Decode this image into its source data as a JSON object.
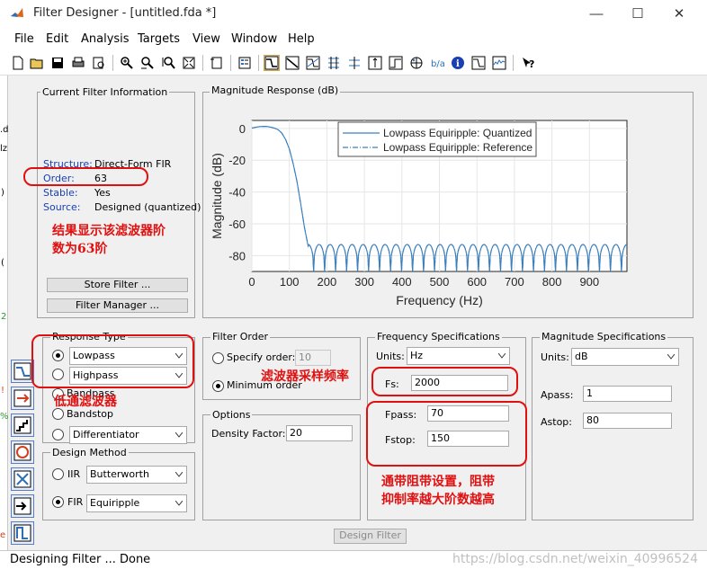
{
  "window": {
    "title": "Filter Designer  -  [untitled.fda *]",
    "minimize": "—",
    "maximize": "☐",
    "close": "✕"
  },
  "menus": [
    "File",
    "Edit",
    "Analysis",
    "Targets",
    "View",
    "Window",
    "Help"
  ],
  "toolbar": {
    "icons": [
      "new-icon",
      "open-icon",
      "save-icon",
      "print-icon",
      "print-preview-icon",
      "zoom-in-icon",
      "zoom-x-icon",
      "zoom-y-icon",
      "full-view-icon",
      "new-plot-icon",
      "legend-icon",
      "magnitude-icon",
      "phase-icon",
      "mag-phase-icon",
      "group-delay-icon",
      "phase-delay-icon",
      "impulse-icon",
      "step-icon",
      "pole-zero-icon",
      "coefficients-icon",
      "info-icon",
      "magnitude-estimate-icon",
      "noise-icon",
      "whats-this-icon"
    ],
    "active": [
      "magnitude-icon"
    ]
  },
  "current_filter": {
    "title": "Current Filter Information",
    "rows": [
      {
        "key": "Structure:",
        "value": "Direct-Form FIR"
      },
      {
        "key": "Order:",
        "value": "63"
      },
      {
        "key": "Stable:",
        "value": "Yes"
      },
      {
        "key": "Source:",
        "value": "Designed (quantized)"
      }
    ],
    "store_button": "Store Filter ...",
    "manager_button": "Filter Manager ..."
  },
  "plot": {
    "title": "Magnitude Response (dB)"
  },
  "chart_data": {
    "type": "line",
    "xlabel": "Frequency (Hz)",
    "ylabel": "Magnitude (dB)",
    "xlim": [
      0,
      1000
    ],
    "ylim": [
      -90,
      5
    ],
    "xticks": [
      0,
      100,
      200,
      300,
      400,
      500,
      600,
      700,
      800,
      900
    ],
    "yticks": [
      0,
      -20,
      -40,
      -60,
      -80
    ],
    "grid": true,
    "legend_position": "top-right",
    "color": "#3a7fbf",
    "passband": {
      "x": [
        0,
        10,
        20,
        30,
        40,
        50,
        60,
        70,
        80,
        90,
        100,
        110,
        120,
        130,
        140,
        150
      ],
      "y": [
        0.2,
        0.7,
        1.1,
        1.3,
        1.2,
        0.8,
        0.2,
        -0.8,
        -3,
        -7,
        -13,
        -22,
        -33,
        -47,
        -62,
        -74
      ]
    },
    "stopband": {
      "fstop": 150,
      "fmax": 1000,
      "lobes": 29,
      "peak_db": -73,
      "floor_db": -90
    },
    "series": [
      {
        "name": "Lowpass Equiripple: Quantized",
        "style": "solid"
      },
      {
        "name": "Lowpass Equiripple: Reference",
        "style": "dashdot"
      }
    ]
  },
  "response_type": {
    "title": "Response Type",
    "lowpass_selected": "Lowpass",
    "highpass_selected": "Highpass",
    "bandpass": "Bandpass",
    "bandstop": "Bandstop",
    "differentiator": "Differentiator"
  },
  "design_method": {
    "title": "Design Method",
    "iir_label": "IIR",
    "iir_value": "Butterworth",
    "fir_label": "FIR",
    "fir_value": "Equiripple"
  },
  "filter_order": {
    "title": "Filter Order",
    "specify_label": "Specify order:",
    "specify_value": "10",
    "minimum_label": "Minimum order"
  },
  "options": {
    "title": "Options",
    "density_label": "Density Factor:",
    "density_value": "20"
  },
  "freq_specs": {
    "title": "Frequency Specifications",
    "units_label": "Units:",
    "units_value": "Hz",
    "fs_label": "Fs:",
    "fs_value": "2000",
    "fpass_label": "Fpass:",
    "fpass_value": "70",
    "fstop_label": "Fstop:",
    "fstop_value": "150"
  },
  "mag_specs": {
    "title": "Magnitude Specifications",
    "units_label": "Units:",
    "units_value": "dB",
    "apass_label": "Apass:",
    "apass_value": "1",
    "astop_label": "Astop:",
    "astop_value": "80"
  },
  "design_button": "Design Filter",
  "status": "Designing Filter ... Done",
  "watermark": "https://blog.csdn.net/weixin_40996524",
  "annotations": {
    "order_note_1": "结果显示该滤波器阶",
    "order_note_2": "数为63阶",
    "lowpass_note": "低通滤波器",
    "fs_note": "滤波器采样频率",
    "band_note_1": "通带阻带设置，阻带",
    "band_note_2": "抑制率越大阶数越高",
    "color": "#e01010"
  },
  "left_strip_glyphs": [
    ".d",
    "lz",
    ")",
    "(",
    "2",
    "!",
    "%",
    "e"
  ]
}
